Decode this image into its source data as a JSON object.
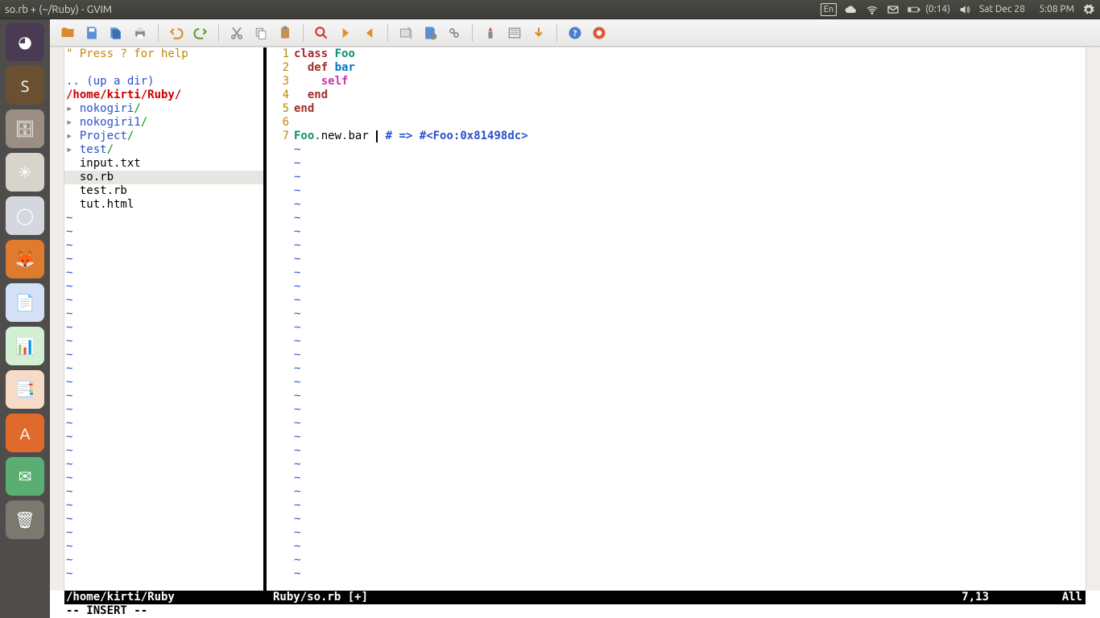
{
  "menubar": {
    "title": "so.rb + (~/Ruby) - GVIM",
    "lang": "En",
    "battery": "(0:14)",
    "date": "Sat Dec 28",
    "time": "5:08 PM"
  },
  "launcher": {
    "items": [
      {
        "name": "dash",
        "bg": "#4a3b55",
        "glyph": "◕"
      },
      {
        "name": "sublime",
        "bg": "#6a5030",
        "glyph": "S"
      },
      {
        "name": "files",
        "bg": "#9a8f82",
        "glyph": "🗄"
      },
      {
        "name": "keepass",
        "bg": "#d8d4cc",
        "glyph": "✳"
      },
      {
        "name": "chromium",
        "bg": "#d4d8de",
        "glyph": "◯"
      },
      {
        "name": "firefox",
        "bg": "#e07a2e",
        "glyph": "🦊"
      },
      {
        "name": "writer",
        "bg": "#d4e1f4",
        "glyph": "📄"
      },
      {
        "name": "calc",
        "bg": "#d4f0d4",
        "glyph": "📊"
      },
      {
        "name": "impress",
        "bg": "#f6dcc8",
        "glyph": "📑"
      },
      {
        "name": "software",
        "bg": "#e0692c",
        "glyph": "A"
      },
      {
        "name": "pidgin",
        "bg": "#5aae72",
        "glyph": "✉"
      },
      {
        "name": "trash",
        "bg": "#7a786f",
        "glyph": "🗑"
      }
    ]
  },
  "filetree": {
    "help": "\" Press ? for help",
    "updir": ".. (up a dir)",
    "path": "/home/kirti/Ruby/",
    "dirs": [
      "nokogiri",
      "nokogiri1",
      "Project",
      "test"
    ],
    "files": [
      "input.txt",
      "so.rb",
      "test.rb",
      "tut.html"
    ],
    "selected": "so.rb"
  },
  "code": {
    "lines": [
      {
        "n": 1,
        "html": "<span class=\"kw-class\">class</span> <span class=\"kw-name\">Foo</span>"
      },
      {
        "n": 2,
        "html": "  <span class=\"kw-def\">def</span> <span class=\"kw-method\">bar</span>"
      },
      {
        "n": 3,
        "html": "    <span class=\"kw-self\">self</span>"
      },
      {
        "n": 4,
        "html": "  <span class=\"kw-end\">end</span>"
      },
      {
        "n": 5,
        "html": "<span class=\"kw-end\">end</span>"
      },
      {
        "n": 6,
        "html": ""
      },
      {
        "n": 7,
        "html": "<span class=\"kw-name\">Foo</span><span class=\"kw-dot\">.</span>new<span class=\"kw-dot\">.</span>bar <span class=\"cursor\"></span> <span class=\"kw-comment\"># =&gt; #&lt;Foo:0x81498dc&gt;</span>"
      }
    ]
  },
  "status": {
    "left": "/home/kirti/Ruby",
    "right_file": "Ruby/so.rb [+]",
    "position": "7,13",
    "percent": "All",
    "mode": "-- INSERT --"
  }
}
